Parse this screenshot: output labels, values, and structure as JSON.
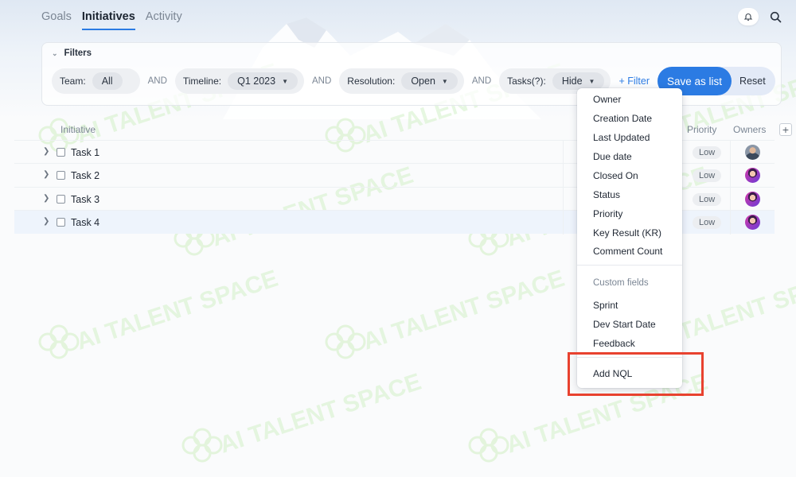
{
  "tabs": [
    {
      "label": "Goals",
      "active": false
    },
    {
      "label": "Initiatives",
      "active": true
    },
    {
      "label": "Activity",
      "active": false
    }
  ],
  "top_icons": {
    "notification": "bell-icon",
    "search": "search-icon"
  },
  "filters": {
    "title": "Filters",
    "conjunction": "AND",
    "team": {
      "label": "Team:",
      "value": "All"
    },
    "timeline": {
      "label": "Timeline:",
      "value": "Q1 2023"
    },
    "resolution": {
      "label": "Resolution:",
      "value": "Open"
    },
    "tasks": {
      "label": "Tasks(?):",
      "value": "Hide"
    },
    "add_filter": "+ Filter",
    "save_as_list": "Save as list",
    "reset": "Reset"
  },
  "table": {
    "columns": {
      "initiative": "Initiative",
      "priority": "Priority",
      "owners": "Owners"
    },
    "rows": [
      {
        "name": "Task 1",
        "priority": "Low",
        "avatar": "avatar-1"
      },
      {
        "name": "Task 2",
        "priority": "Low",
        "avatar": "avatar-2"
      },
      {
        "name": "Task 3",
        "priority": "Low",
        "avatar": "avatar-2"
      },
      {
        "name": "Task 4",
        "priority": "Low",
        "avatar": "avatar-2"
      }
    ]
  },
  "dropdown": {
    "items": [
      "Owner",
      "Creation Date",
      "Last Updated",
      "Due date",
      "Closed On",
      "Status",
      "Priority",
      "Key Result (KR)",
      "Comment Count"
    ],
    "custom_fields_label": "Custom fields",
    "custom_items": [
      "Sprint",
      "Dev Start Date",
      "Feedback"
    ],
    "add_nql": "Add NQL"
  },
  "watermark_text": "AI TALENT SPACE",
  "colors": {
    "accent": "#2b7be3",
    "highlight_box": "#e8422f",
    "watermark": "#d6f2cc"
  }
}
